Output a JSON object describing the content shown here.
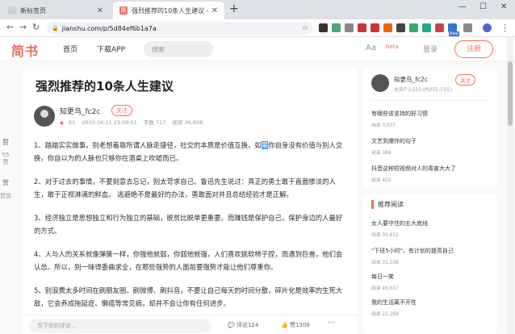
{
  "browser": {
    "tabs": [
      {
        "title": "新标签页",
        "active": false
      },
      {
        "title": "强烈推荐的10条人生建议 - 简书",
        "active": true
      }
    ],
    "new_tab": "+",
    "url": "jianshu.com/p/5d84ef6b1a7a",
    "window_controls": {
      "minimize": "—",
      "maximize": "☐",
      "close": "✕"
    },
    "extension_badge": "New"
  },
  "header": {
    "logo": "简书",
    "nav_home": "首页",
    "nav_app": "下载APP",
    "search_placeholder": "搜索",
    "aa": "Aa",
    "beta": "beta",
    "login": "登录",
    "register": "注册"
  },
  "left_float": {
    "like_label": "赞",
    "like_caption": "55赞",
    "reward_label": "赏",
    "reward_caption": "赞赏"
  },
  "article": {
    "title": "强烈推荐的10条人生建议",
    "author": "知更鸟_fc2c",
    "follow": "关注",
    "diamond": "65",
    "date": "2020.04.11 23:09:51",
    "words": "字数 717",
    "reads": "阅读 36,828",
    "paragraphs": [
      {
        "before": "1、踏踏实实做事，别老想着靠所谓人脉走捷径，社交的本质是价值互换，如",
        "hl": "果",
        "after": "你自身没有价值与别人交换，你自以为的人脉也只够你在酒桌上吹嘘而已。"
      },
      {
        "before": "2、对于过去的事情，不要刻意去忘记，别太苛求自己。鲁迅先生说过：真正的勇士敢于直面惨淡的人生，敢于正视淋漓的鲜血。 逃避绝不是最好的办法，勇敢面对并且总结经验才是正解。",
        "hl": "",
        "after": ""
      },
      {
        "before": "3、经济独立是思想独立和行为独立的基础，脱贫比脱单更重要。而赚钱是保护自己，保护身边的人最好的方式。",
        "hl": "",
        "after": ""
      },
      {
        "before": "4、人与人的关系就像弹簧一样，你强他就弱，你弱他就强，人们喜欢挑软柿子捏，而遇到巨兽，他们会认怂。所以，别一味得委曲求全，在那些强势的人面前要强势才能让他们尊重你。",
        "hl": "",
        "after": ""
      },
      {
        "before": "5、别浪费太多时间在刷朋友圈、刷微博、刷抖音，不要让自己每天的时间分散，碎片化是效率的生死大敌，它会养成拖延症、懒癌等常见病，却并不会让你有任何进步。",
        "hl": "",
        "after": ""
      }
    ]
  },
  "comment_bar": {
    "placeholder": "写下你的评论...",
    "comments": "评论124",
    "likes": "赞1308",
    "more": "···"
  },
  "sidebar": {
    "author": "知更鸟_fc2c",
    "follow": "关注",
    "stats": "总资产2,551 (约255.73元)",
    "items": [
      {
        "title": "有哪些该坚持的好习惯",
        "reads": "阅读 3,507"
      },
      {
        "title": "文艺到爆炸的句子",
        "reads": "阅读 388"
      },
      {
        "title": "抖音这种短视频对人的毒害大大了",
        "reads": "阅读 402"
      }
    ],
    "recommend_title": "推荐阅读",
    "recommend": [
      {
        "title": "女人要守住的五大底线",
        "reads": "阅读 35,852"
      },
      {
        "title": "\"下班5小时\"，有计划的提高自己",
        "reads": "阅读 31,208"
      },
      {
        "title": "每日一笑",
        "reads": "阅读 46,697"
      },
      {
        "title": "我的生活离不开性",
        "reads": "阅读 22,268"
      }
    ]
  },
  "colors": {
    "brand": "#ea6f5a",
    "highlight": "#3297fd"
  }
}
